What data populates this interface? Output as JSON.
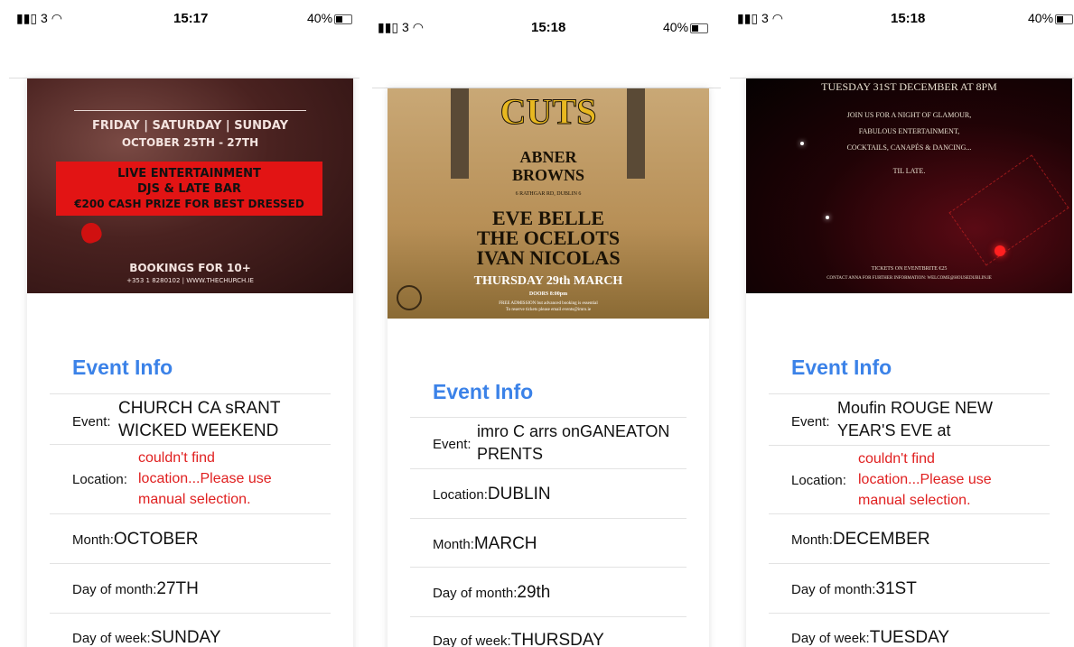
{
  "screens": [
    {
      "status": {
        "signal": "3",
        "time": "15:17",
        "battery": "40%"
      },
      "poster": {
        "days": "FRIDAY | SATURDAY | SUNDAY",
        "dates": "OCTOBER 25TH - 27TH",
        "banner": [
          "LIVE ENTERTAINMENT",
          "DJS & LATE BAR",
          "€200 CASH PRIZE FOR BEST DRESSED"
        ],
        "bookings": "BOOKINGS FOR 10+",
        "contact": "+353 1 8280102 | WWW.THECHURCH.IE"
      },
      "event_info_title": "Event Info",
      "event": {
        "label": "Event:",
        "value": "CHURCH CA sRANT WICKED WEEKEND"
      },
      "location": {
        "label": "Location:",
        "value": "couldn't find location...Please use manual selection."
      },
      "month": {
        "label": "Month:",
        "value": "OCTOBER"
      },
      "day_of_month": {
        "label": "Day of month:",
        "value": "27TH"
      },
      "day_of_week": {
        "label": "Day of week:",
        "value": "SUNDAY"
      }
    },
    {
      "status": {
        "signal": "3",
        "time": "15:18",
        "battery": "40%"
      },
      "poster": {
        "title_top": "CUTS",
        "venue1": "ABNER",
        "venue2": "BROWNS",
        "address": "6 RATHGAR RD, DUBLIN 6",
        "acts": [
          "EVE BELLE",
          "THE OCELOTS",
          "IVAN NICOLAS"
        ],
        "date": "THURSDAY 29th MARCH",
        "doors": "DOORS 8:00pm",
        "admission1": "FREE ADMISSION but advanced booking is essential",
        "admission2": "To reserve tickets please email events@imro.ie"
      },
      "event_info_title": "Event Info",
      "event": {
        "label": "Event:",
        "value": "imro C arrs onGANEATON PRENTS"
      },
      "location": {
        "label": "Location:",
        "value": "DUBLIN"
      },
      "month": {
        "label": "Month:",
        "value": "MARCH"
      },
      "day_of_month": {
        "label": "Day of month:",
        "value": "29th"
      },
      "day_of_week": {
        "label": "Day of week:",
        "value": "THURSDAY"
      }
    },
    {
      "status": {
        "signal": "3",
        "time": "15:18",
        "battery": "40%"
      },
      "poster": {
        "date": "TUESDAY 31ST DECEMBER AT 8PM",
        "lines": [
          "JOIN US FOR A NIGHT OF GLAMOUR,",
          "FABULOUS ENTERTAINMENT,",
          "COCKTAILS, CANAPÉS & DANCING...",
          "TIL LATE."
        ],
        "tickets": "TICKETS ON EVENTBRITE €25",
        "contact": "CONTACT ANNA FOR FURTHER INFORMATION: WELCOME@HOUSEDUBLIN.IE"
      },
      "event_info_title": "Event Info",
      "event": {
        "label": "Event:",
        "value": "Moufin ROUGE NEW YEAR'S EVE at"
      },
      "location": {
        "label": "Location:",
        "value": "couldn't find location...Please use manual selection."
      },
      "month": {
        "label": "Month:",
        "value": "DECEMBER"
      },
      "day_of_month": {
        "label": "Day of month:",
        "value": "31ST"
      },
      "day_of_week": {
        "label": "Day of week:",
        "value": "TUESDAY"
      }
    }
  ]
}
